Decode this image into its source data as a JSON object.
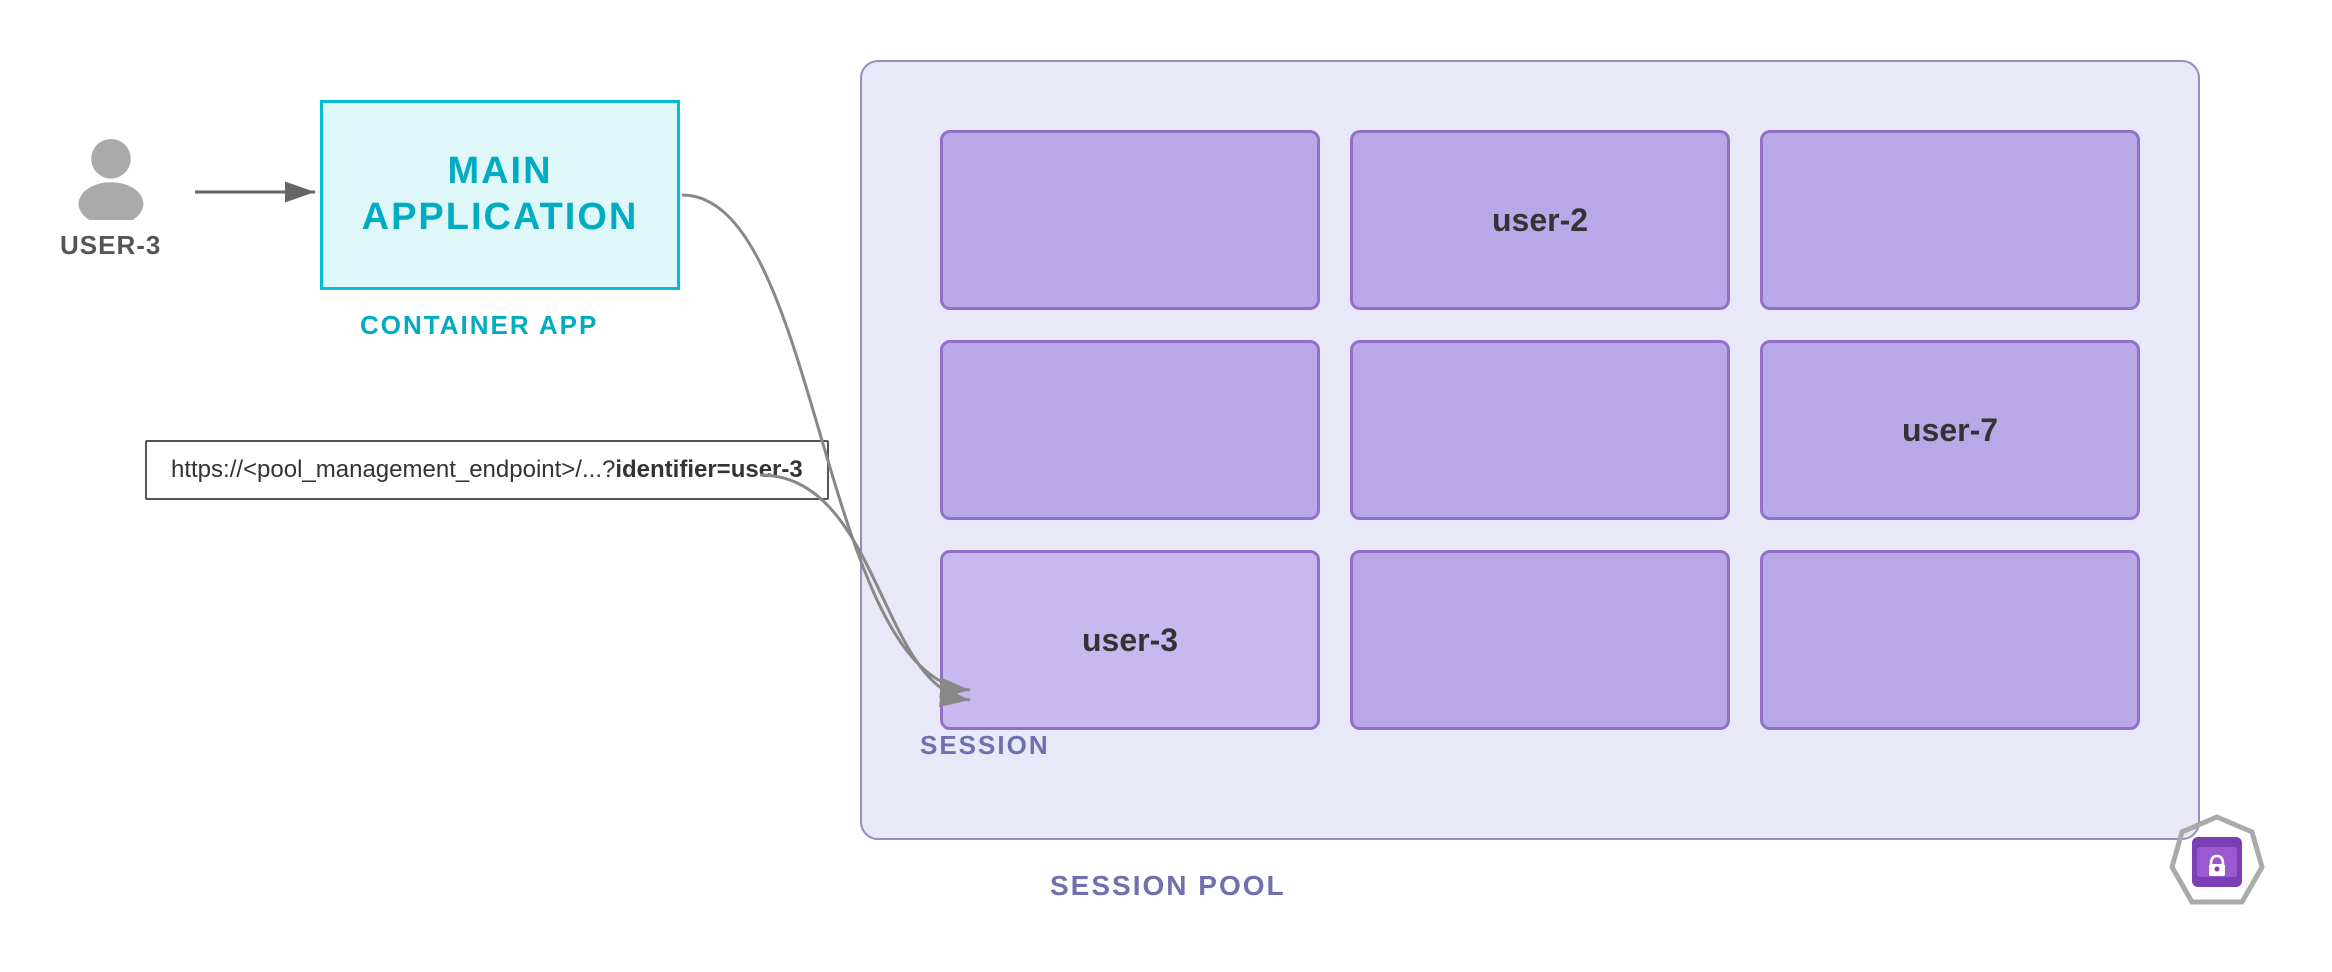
{
  "user": {
    "label": "USER-3"
  },
  "mainApp": {
    "line1": "MAIN",
    "line2": "APPLICATION",
    "containerLabel": "CONTAINER APP"
  },
  "urlBox": {
    "prefix": "https://<pool_management_endpoint>/...?",
    "bold": "identifier=user-3"
  },
  "sessionPool": {
    "label": "SESSION POOL",
    "sessionLabel": "SESSION"
  },
  "sessions": [
    {
      "id": 1,
      "label": "",
      "row": 0,
      "col": 0
    },
    {
      "id": 2,
      "label": "user-2",
      "row": 0,
      "col": 1
    },
    {
      "id": 3,
      "label": "",
      "row": 0,
      "col": 2
    },
    {
      "id": 4,
      "label": "",
      "row": 1,
      "col": 0
    },
    {
      "id": 5,
      "label": "",
      "row": 1,
      "col": 1
    },
    {
      "id": 6,
      "label": "user-7",
      "row": 1,
      "col": 2
    },
    {
      "id": 7,
      "label": "user-3",
      "row": 2,
      "col": 0,
      "highlighted": true
    },
    {
      "id": 8,
      "label": "",
      "row": 2,
      "col": 1
    },
    {
      "id": 9,
      "label": "",
      "row": 2,
      "col": 2
    }
  ]
}
